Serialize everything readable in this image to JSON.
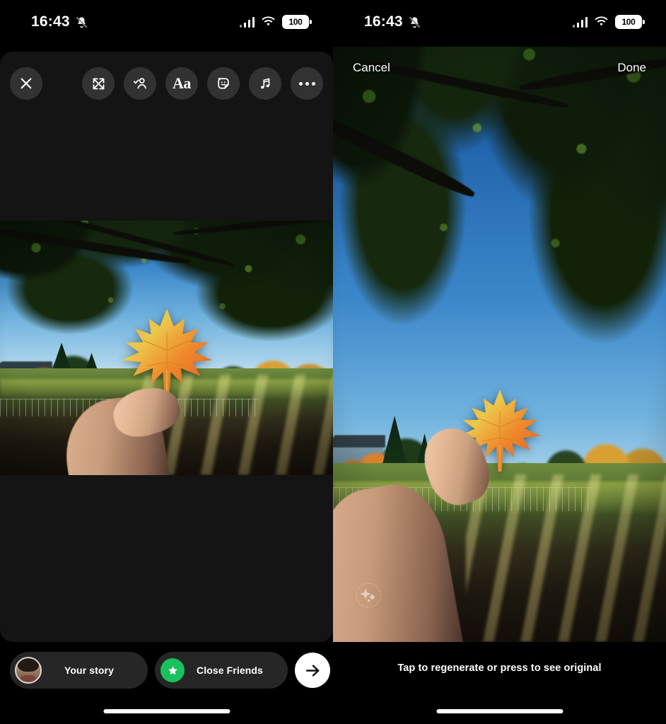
{
  "status_bar": {
    "time": "16:43",
    "battery_percent": "100",
    "icons": [
      "bell-muted-icon",
      "cellular-signal-icon",
      "wifi-icon",
      "battery-icon"
    ]
  },
  "left_panel": {
    "name": "instagram-story-composer",
    "toolbar": {
      "close_label": "Close",
      "items": [
        {
          "icon": "expand-icon",
          "label": "Expand"
        },
        {
          "icon": "tag-people-icon",
          "label": "Tag people"
        },
        {
          "icon": "text-icon",
          "label": "Aa"
        },
        {
          "icon": "sticker-icon",
          "label": "Stickers"
        },
        {
          "icon": "music-note-icon",
          "label": "Music"
        },
        {
          "icon": "more-options-icon",
          "label": "More"
        }
      ]
    },
    "share_bar": {
      "your_story_label": "Your story",
      "close_friends_label": "Close Friends",
      "send_label": "Send",
      "avatar_name": "avatar",
      "close_friends_color": "#19c25d"
    }
  },
  "right_panel": {
    "name": "ai-restyle-preview",
    "cancel_label": "Cancel",
    "done_label": "Done",
    "hint": "Tap to regenerate or press to see original",
    "watermark": "imagined-with-ai-badge"
  },
  "photo": {
    "alt": "Hand holding an orange maple leaf under a large tree with autumn foliage and a lawn",
    "colors": {
      "sky": "#6fb2de",
      "leaf_orange": "#f08a2c",
      "leaf_yellow": "#ecc84a",
      "grass": "#6e8c3e",
      "canopy": "#14250e",
      "skin": "#e5b794"
    }
  }
}
